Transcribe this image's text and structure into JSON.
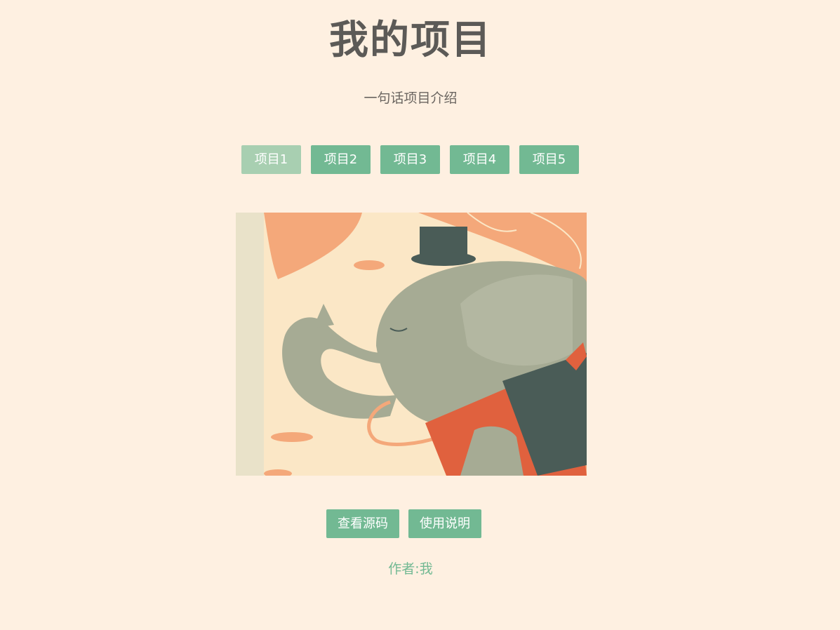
{
  "header": {
    "title": "我的项目",
    "subtitle": "一句话项目介绍"
  },
  "tabs": [
    {
      "label": "项目1",
      "active": true
    },
    {
      "label": "项目2",
      "active": false
    },
    {
      "label": "项目3",
      "active": false
    },
    {
      "label": "项目4",
      "active": false
    },
    {
      "label": "项目5",
      "active": false
    }
  ],
  "preview": {
    "image": "elephant-illustration"
  },
  "actions": {
    "source_label": "查看源码",
    "guide_label": "使用说明"
  },
  "footer": {
    "author": "作者:我"
  },
  "colors": {
    "background": "#fef0e1",
    "accent": "#72b993",
    "accent_active": "#a8cfb1",
    "title": "#5c5a57"
  }
}
